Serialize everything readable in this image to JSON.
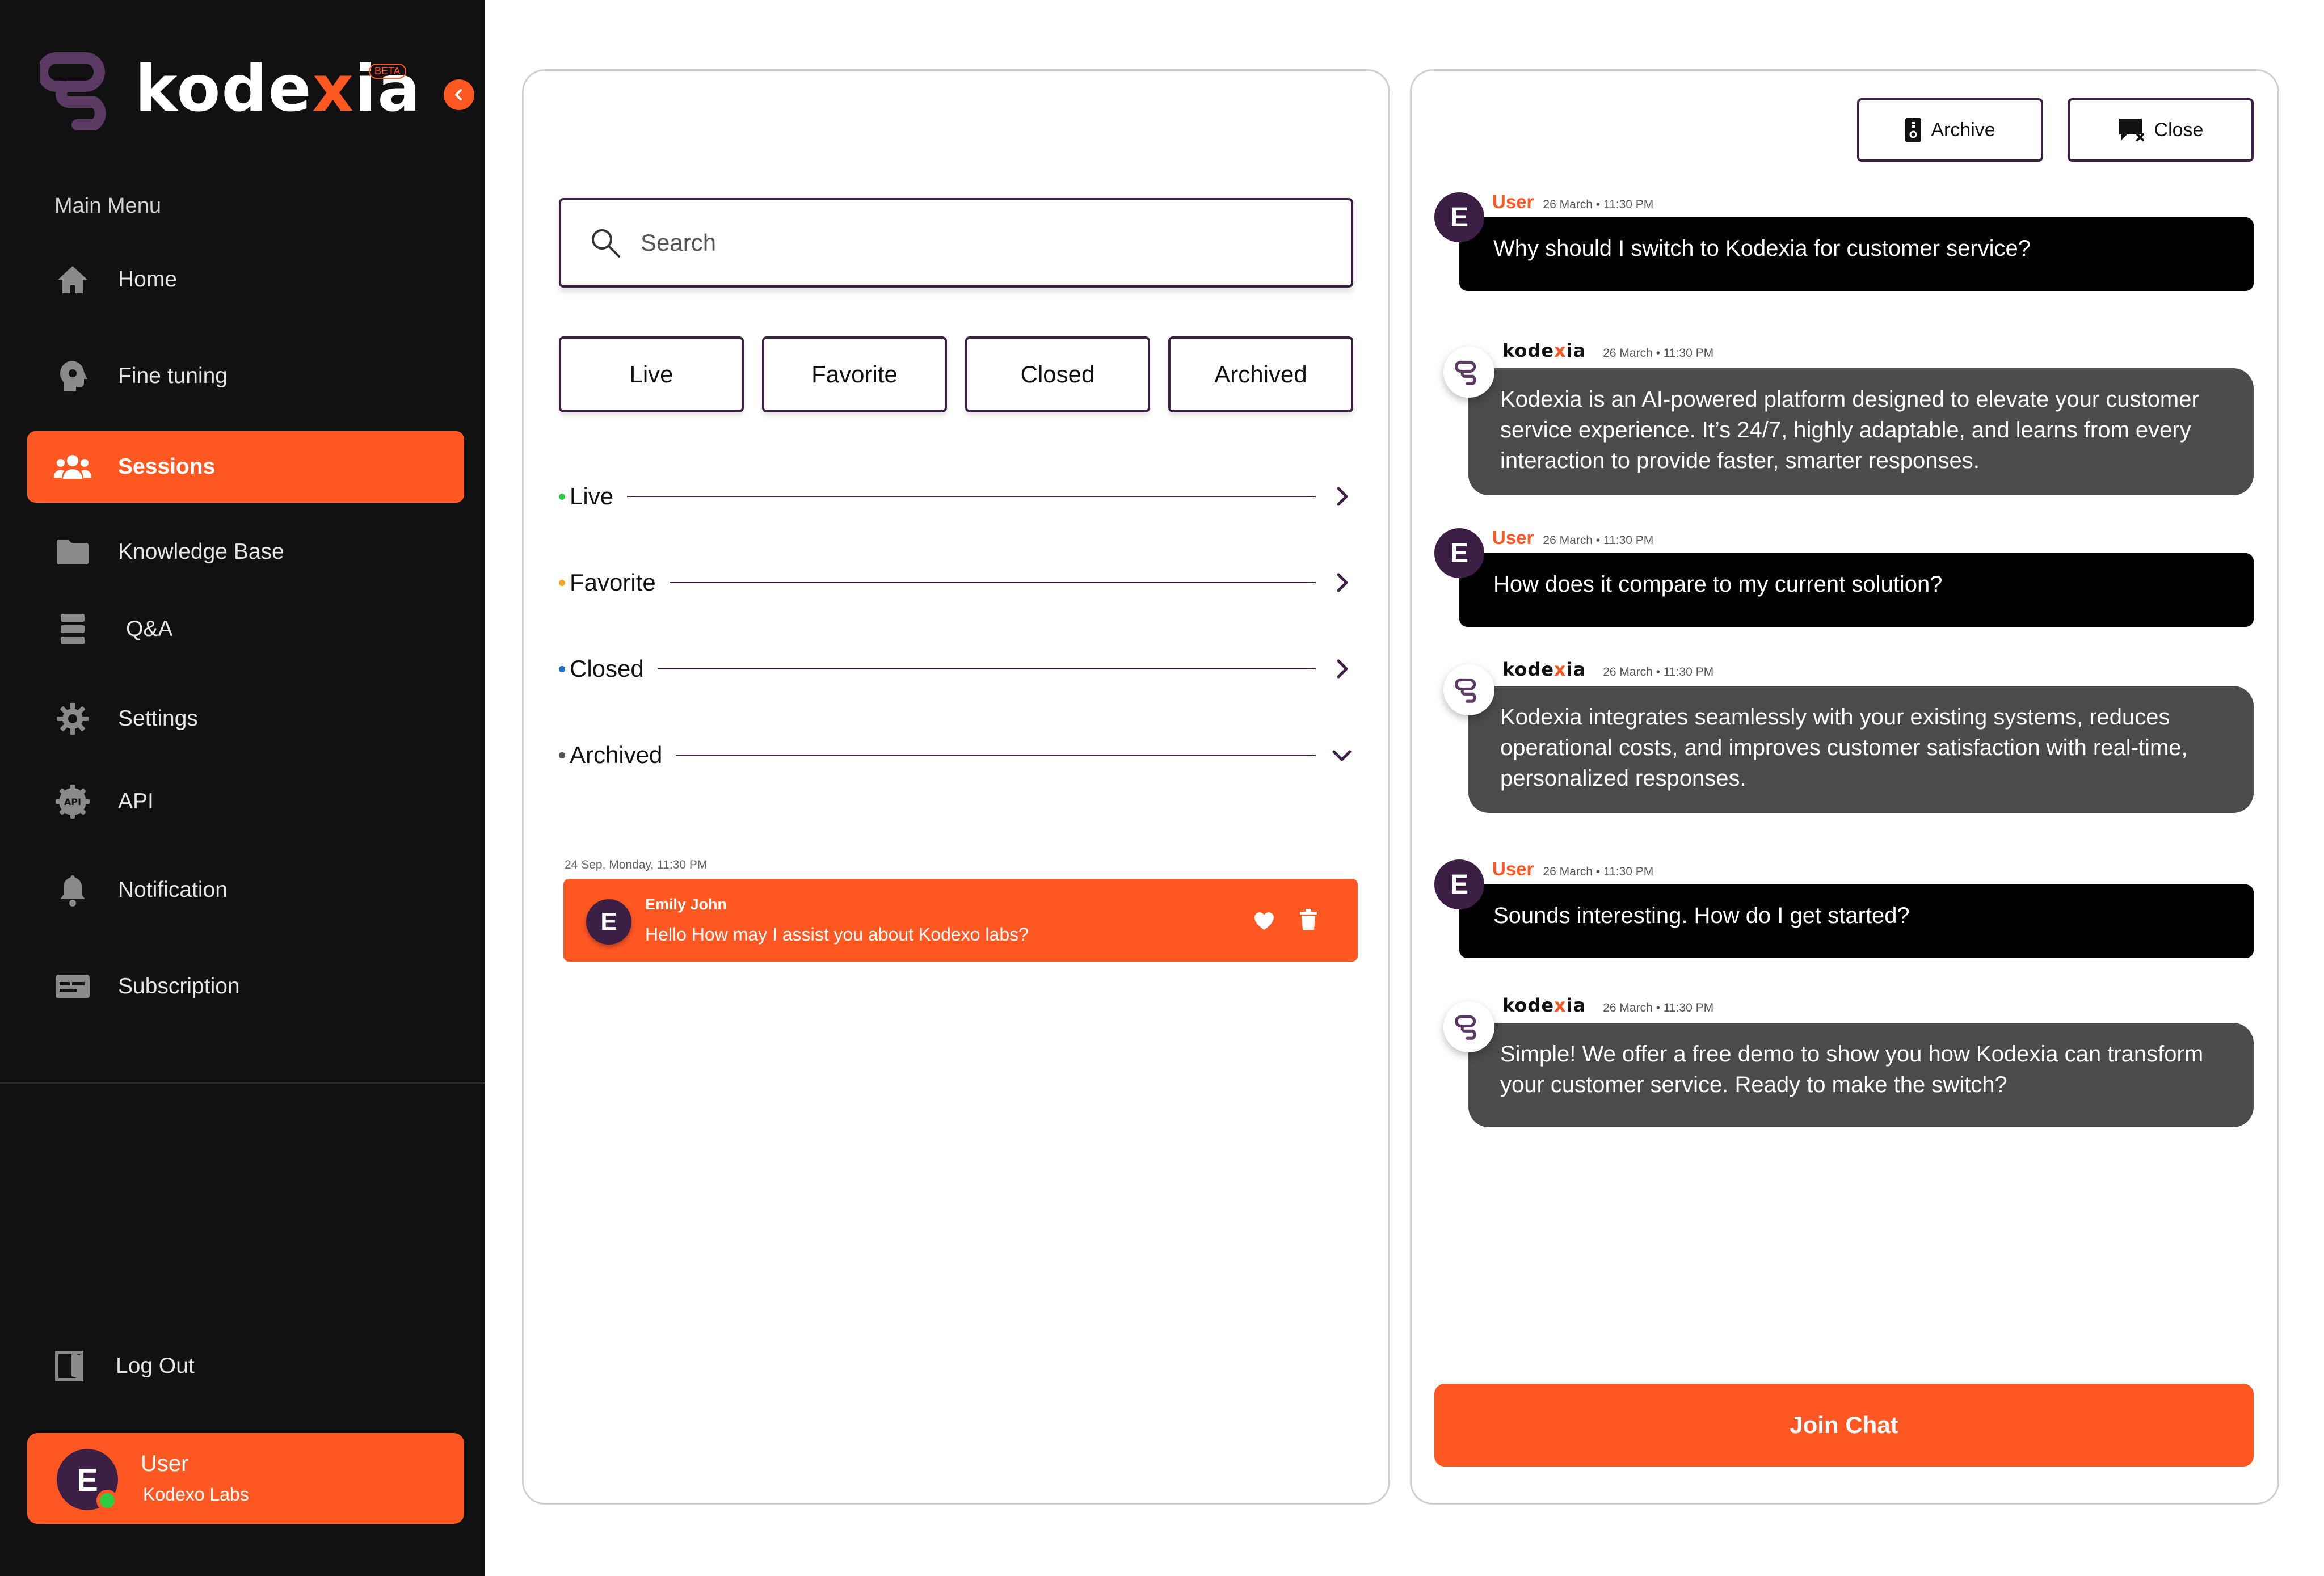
{
  "brand": {
    "name_part1": "kode",
    "name_x": "x",
    "name_part2": "ia",
    "beta": "BETA"
  },
  "sidebar": {
    "menu_label": "Main Menu",
    "items": [
      {
        "label": "Home",
        "icon": "home-icon"
      },
      {
        "label": "Fine tuning",
        "icon": "brain-gear-icon"
      },
      {
        "label": "Sessions",
        "icon": "users-icon",
        "active": true
      },
      {
        "label": "Knowledge Base",
        "icon": "folder-icon"
      },
      {
        "label": "Q&A",
        "icon": "list-icon"
      },
      {
        "label": "Settings",
        "icon": "gear-icon"
      },
      {
        "label": "API",
        "icon": "api-icon"
      },
      {
        "label": "Notification",
        "icon": "bell-icon"
      },
      {
        "label": "Subscription",
        "icon": "card-icon"
      }
    ],
    "logout": "Log Out",
    "user": {
      "initial": "E",
      "name": "User",
      "org": "Kodexo Labs",
      "status": "online"
    }
  },
  "sessions": {
    "search_placeholder": "Search",
    "tabs": [
      "Live",
      "Favorite",
      "Closed",
      "Archived"
    ],
    "sections": [
      {
        "label": "Live",
        "color": "#2ecc40",
        "expanded": false
      },
      {
        "label": "Favorite",
        "color": "#f5a623",
        "expanded": false
      },
      {
        "label": "Closed",
        "color": "#1f6fd1",
        "expanded": false
      },
      {
        "label": "Archived",
        "color": "#555555",
        "expanded": true
      }
    ],
    "archived_date": "24 Sep, Monday, 11:30 PM",
    "archived_session": {
      "initial": "E",
      "name": "Emily John",
      "message": "Hello How may I assist you about Kodexo labs?"
    }
  },
  "chat": {
    "archive_label": "Archive",
    "close_label": "Close",
    "messages": [
      {
        "from": "User",
        "time": "26 March • 11:30 PM",
        "text": "Why should I switch to Kodexia for customer service?"
      },
      {
        "from": "bot",
        "time": "26 March • 11:30 PM",
        "text": "Kodexia is an AI-powered platform designed to elevate your customer service experience. It’s 24/7, highly adaptable, and learns from every interaction to provide faster, smarter responses."
      },
      {
        "from": "User",
        "time": "26 March • 11:30 PM",
        "text": "How does it compare to my current solution?"
      },
      {
        "from": "bot",
        "time": "26 March • 11:30 PM",
        "text": "Kodexia integrates seamlessly with your existing systems, reduces operational costs, and improves customer satisfaction with real-time, personalized responses."
      },
      {
        "from": "User",
        "time": "26 March • 11:30 PM",
        "text": "Sounds interesting. How do I get started?"
      },
      {
        "from": "bot",
        "time": "26 March • 11:30 PM",
        "text": "Simple! We offer a free demo to show you how Kodexia can transform your customer service. Ready to make the switch?"
      }
    ],
    "user_initial": "E",
    "join_label": "Join Chat"
  },
  "colors": {
    "accent": "#FF5722",
    "dark": "#111111",
    "purple": "#3B1F44",
    "bot_bubble": "#4b4b4b"
  }
}
